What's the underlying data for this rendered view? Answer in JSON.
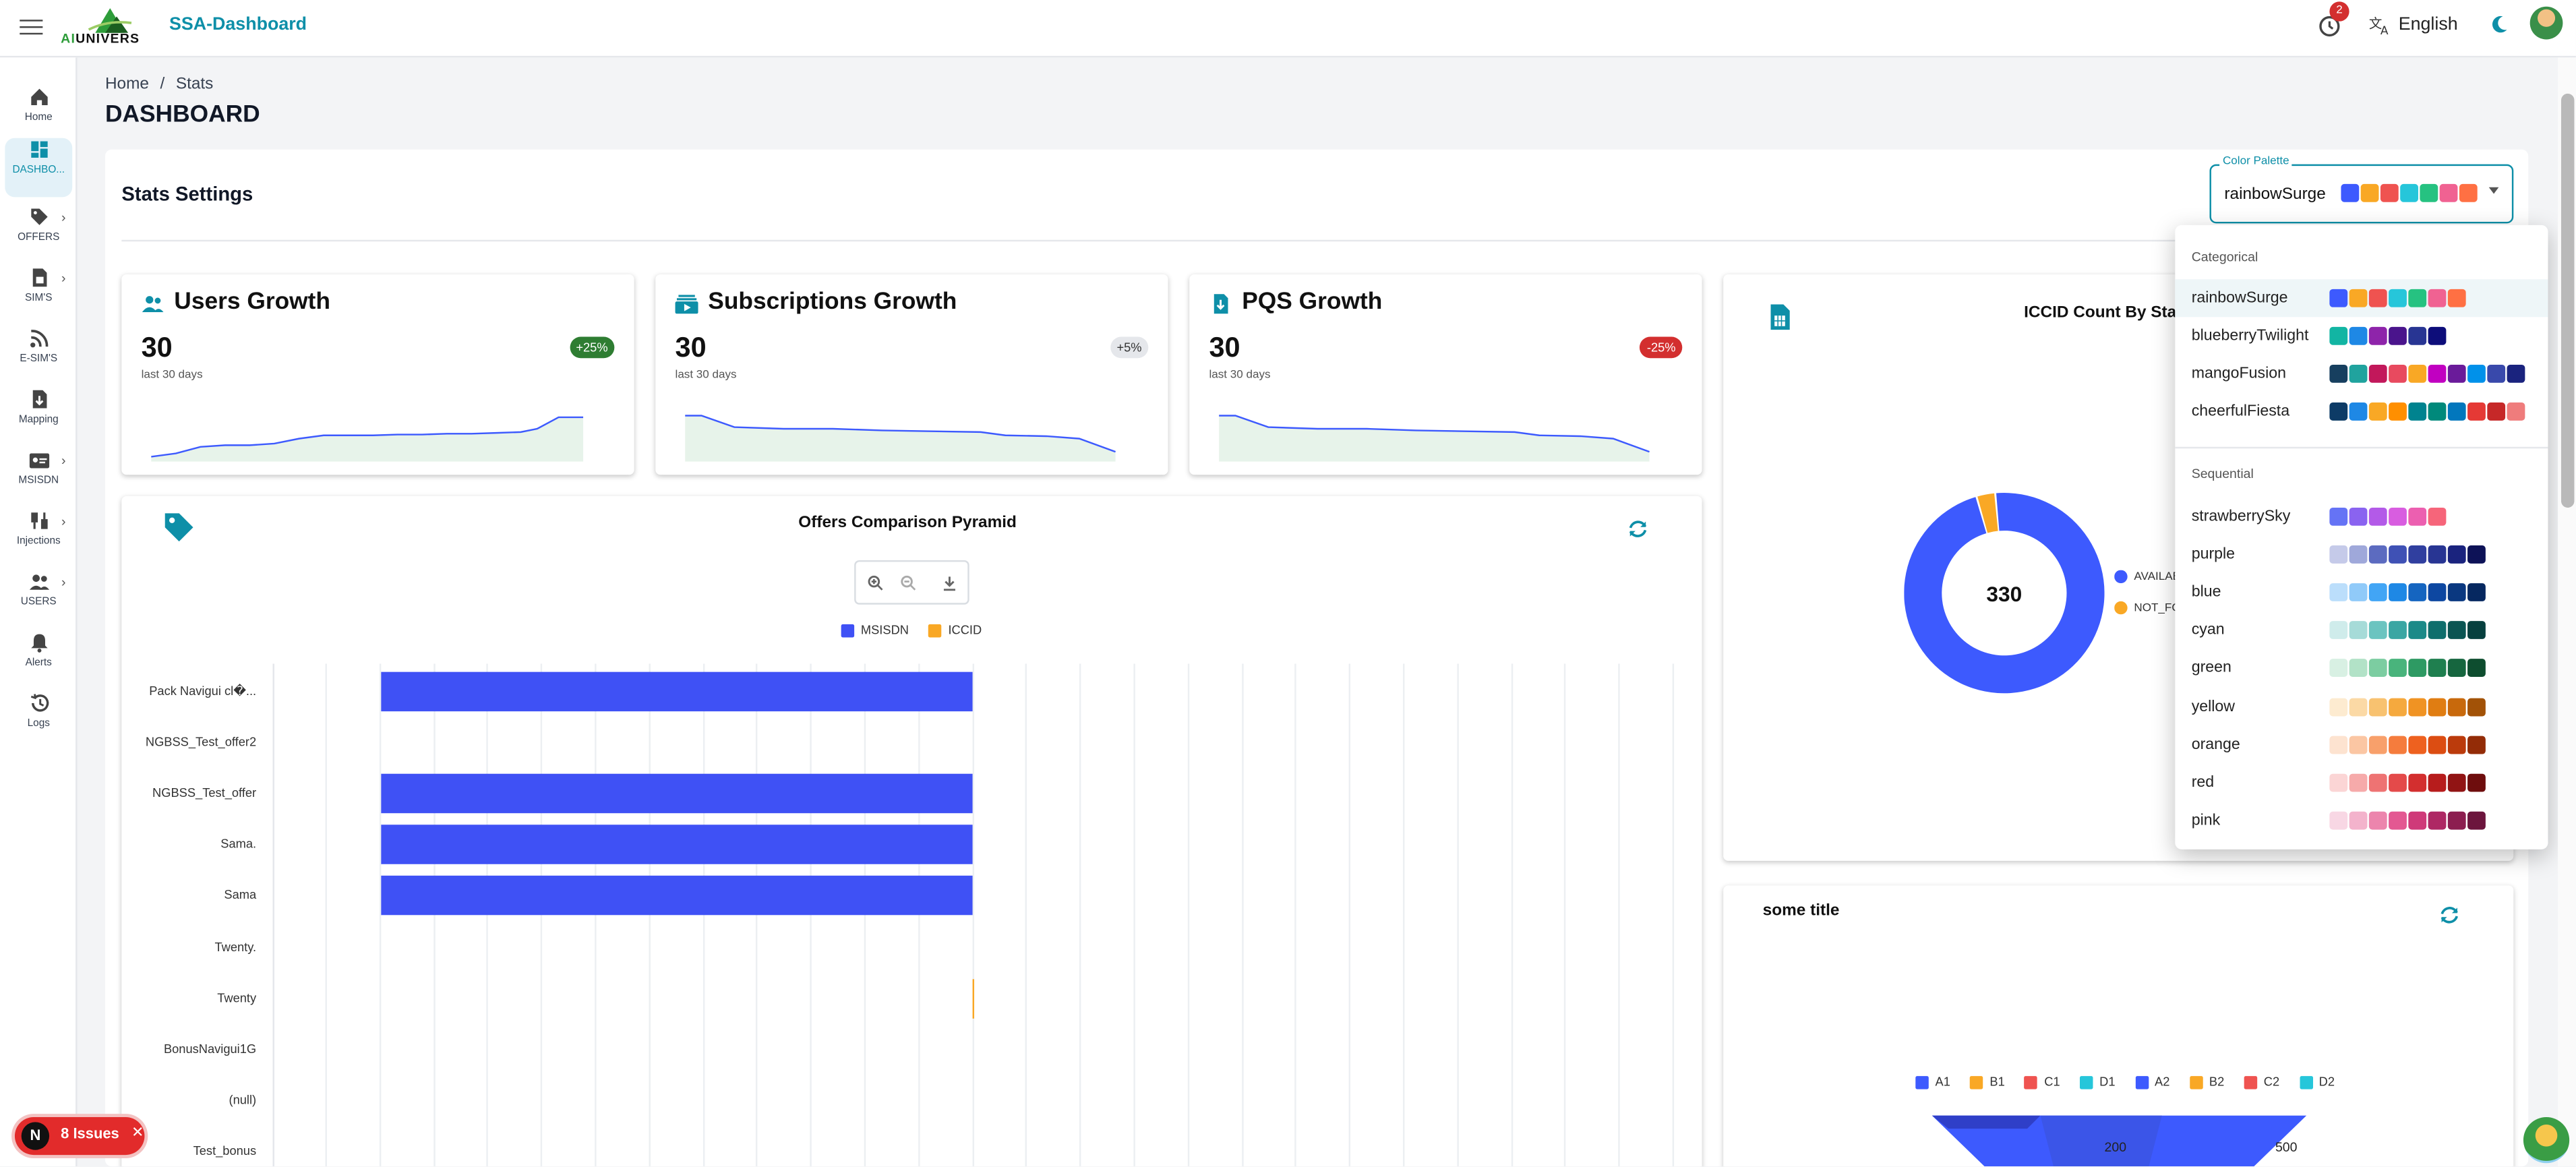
{
  "app": {
    "title": "SSA-Dashboard",
    "logo_text_prefix": "AI",
    "logo_text_suffix": "UNIVERS"
  },
  "topbar": {
    "notifications_count": "2",
    "language": "English"
  },
  "sidebar": {
    "items": [
      {
        "label": "Home",
        "icon": "home-icon",
        "chevron": false
      },
      {
        "label": "DASHBO...",
        "icon": "dashboard-icon",
        "chevron": false,
        "active": true
      },
      {
        "label": "OFFERS",
        "icon": "tag-icon",
        "chevron": true
      },
      {
        "label": "SIM'S",
        "icon": "sim-icon",
        "chevron": true
      },
      {
        "label": "E-SIM'S",
        "icon": "rss-icon",
        "chevron": false
      },
      {
        "label": "Mapping",
        "icon": "mapping-icon",
        "chevron": false
      },
      {
        "label": "MSISDN",
        "icon": "id-card-icon",
        "chevron": true
      },
      {
        "label": "Injections",
        "icon": "plug-icon",
        "chevron": true
      },
      {
        "label": "USERS",
        "icon": "users-icon",
        "chevron": true
      },
      {
        "label": "Alerts",
        "icon": "alert-icon",
        "chevron": false
      },
      {
        "label": "Logs",
        "icon": "history-icon",
        "chevron": false
      }
    ]
  },
  "breadcrumb": {
    "home": "Home",
    "sep": "/",
    "current": "Stats"
  },
  "page_title": "DASHBOARD",
  "settings": {
    "title": "Stats Settings",
    "palette_label": "Color Palette",
    "palette_value": "rainbowSurge",
    "palette_swatches": [
      "#3d5afe",
      "#f9a825",
      "#ef5350",
      "#26c6da",
      "#26c281",
      "#f06292",
      "#ff7043"
    ]
  },
  "stats": [
    {
      "title": "Users Growth",
      "value": "30",
      "sub": "last 30 days",
      "badge": "+25%",
      "badge_color": "#2e7d32",
      "badge_text_color": "#ffffff",
      "icon": "users-growth-icon"
    },
    {
      "title": "Subscriptions Growth",
      "value": "30",
      "sub": "last 30 days",
      "badge": "+5%",
      "badge_color": "#e5e7eb",
      "badge_text_color": "#333333",
      "icon": "subscriptions-icon"
    },
    {
      "title": "PQS Growth",
      "value": "30",
      "sub": "last 30 days",
      "badge": "-25%",
      "badge_color": "#d32f2f",
      "badge_text_color": "#ffffff",
      "icon": "pqs-icon"
    }
  ],
  "offers_chart": {
    "title": "Offers Comparison Pyramid",
    "legend": [
      {
        "name": "MSISDN",
        "color": "#3f51f5"
      },
      {
        "name": "ICCID",
        "color": "#f9a825"
      }
    ]
  },
  "iccid_chart": {
    "title": "ICCID Count By Status",
    "center_value": "330",
    "legend": [
      {
        "name": "AVAILABLE",
        "color": "#3d5afe"
      },
      {
        "name": "NOT_FOUND",
        "color": "#f9a825"
      }
    ]
  },
  "some_chart": {
    "title": "some title",
    "legend": [
      {
        "name": "A1",
        "color": "#3d5afe"
      },
      {
        "name": "B1",
        "color": "#f9a825"
      },
      {
        "name": "C1",
        "color": "#ef5350"
      },
      {
        "name": "D1",
        "color": "#26c6da"
      },
      {
        "name": "A2",
        "color": "#3d5afe"
      },
      {
        "name": "B2",
        "color": "#f9a825"
      },
      {
        "name": "C2",
        "color": "#ef5350"
      },
      {
        "name": "D2",
        "color": "#26c6da"
      }
    ],
    "labels": [
      "200",
      "500"
    ]
  },
  "chart_data": [
    {
      "type": "bar",
      "title": "Offers Comparison Pyramid",
      "categories": [
        "Pack Navigui cl�...",
        "NGBSS_Test_offer2",
        "NGBSS_Test_offer",
        "Sama.",
        "Sama",
        "Twenty.",
        "Twenty",
        "BonusNavigui1G",
        "(null)",
        "Test_bonus"
      ],
      "series": [
        {
          "name": "MSISDN",
          "values": [
            1,
            0,
            1,
            1,
            1,
            0,
            0,
            0,
            0,
            0
          ]
        },
        {
          "name": "ICCID",
          "values": [
            0,
            0,
            0,
            0,
            0,
            0,
            0.01,
            0,
            0,
            0
          ]
        }
      ]
    },
    {
      "type": "pie",
      "title": "ICCID Count By Status",
      "center": "330",
      "categories": [
        "AVAILABLE",
        "NOT_FOUND"
      ],
      "values": [
        320,
        10
      ]
    }
  ],
  "dropdown": {
    "groups": [
      {
        "label": "Categorical",
        "items": [
          {
            "name": "rainbowSurge",
            "selected": true,
            "colors": [
              "#3d5afe",
              "#f9a825",
              "#ef5350",
              "#26c6da",
              "#26c281",
              "#f06292",
              "#ff7043"
            ]
          },
          {
            "name": "blueberryTwilight",
            "colors": [
              "#12b5a3",
              "#1e88e5",
              "#8e24aa",
              "#4a148c",
              "#283593",
              "#0d0d7a"
            ]
          },
          {
            "name": "mangoFusion",
            "colors": [
              "#173f5f",
              "#20a39e",
              "#c2185b",
              "#e84a5f",
              "#f9a825",
              "#c100c1",
              "#6a1b9a",
              "#0091ea",
              "#3949ab",
              "#1a237e"
            ]
          },
          {
            "name": "cheerfulFiesta",
            "colors": [
              "#0d3b66",
              "#1e88e5",
              "#f9a825",
              "#ff8f00",
              "#00838f",
              "#00897b",
              "#0277bd",
              "#e53935",
              "#c62828",
              "#ef7c7c"
            ]
          }
        ]
      },
      {
        "label": "Sequential",
        "items": [
          {
            "name": "strawberrySky",
            "colors": [
              "#6573f5",
              "#8a63f0",
              "#b35ae8",
              "#d85de0",
              "#ec5fb0",
              "#f6657a"
            ]
          },
          {
            "name": "purple",
            "colors": [
              "#c5cae9",
              "#9fa8da",
              "#5c6bc0",
              "#3f51b5",
              "#303f9f",
              "#283593",
              "#1a237e",
              "#0d1257"
            ]
          },
          {
            "name": "blue",
            "colors": [
              "#bbdefb",
              "#90caf9",
              "#42a5f5",
              "#1e88e5",
              "#1565c0",
              "#0d47a1",
              "#0a3880",
              "#062860"
            ]
          },
          {
            "name": "cyan",
            "colors": [
              "#cfeceb",
              "#a6dbd8",
              "#6bc4c0",
              "#3aa6a3",
              "#1b8a88",
              "#0f6e6c",
              "#0b5553",
              "#07403f"
            ]
          },
          {
            "name": "green",
            "colors": [
              "#d8f0e3",
              "#b2e2c7",
              "#7ccda1",
              "#49b47c",
              "#2e9a63",
              "#1f7f4f",
              "#16663f",
              "#0e4d2f"
            ]
          },
          {
            "name": "yellow",
            "colors": [
              "#fdebd0",
              "#fbd9a5",
              "#f8c270",
              "#f5a93e",
              "#f09323",
              "#e07d12",
              "#c8690c",
              "#a25207"
            ]
          },
          {
            "name": "orange",
            "colors": [
              "#fde3d0",
              "#fbc6a3",
              "#f8a06b",
              "#f57c3d",
              "#ee611f",
              "#dc4d12",
              "#bb3b0c",
              "#932c07"
            ]
          },
          {
            "name": "red",
            "colors": [
              "#fbd5d5",
              "#f6aaaa",
              "#ee7373",
              "#e44a4a",
              "#d32f2f",
              "#b71c1c",
              "#911414",
              "#6e0d0d"
            ]
          },
          {
            "name": "pink",
            "colors": [
              "#f8d7e4",
              "#f3b3cc",
              "#ec85ad",
              "#e35892",
              "#cf3a79",
              "#ae2864",
              "#8c1e50",
              "#6c153d"
            ]
          }
        ]
      }
    ]
  },
  "issues": {
    "badge": "N",
    "label": "8 Issues"
  }
}
